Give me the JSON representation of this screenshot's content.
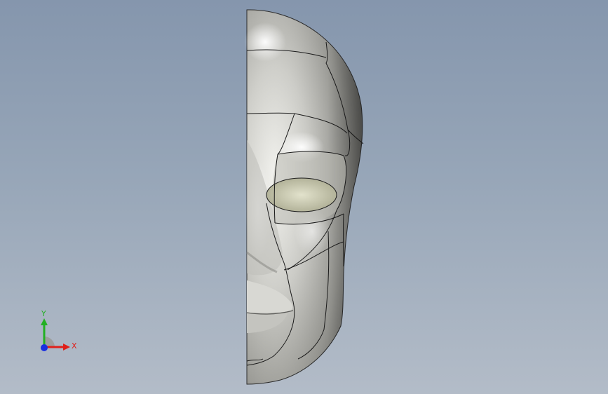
{
  "viewport": {
    "background_top": "#8596ad",
    "background_bottom": "#b3bcc8"
  },
  "model": {
    "name": "half-head-face-surface-model",
    "surface_color": "#c9c9c3",
    "edge_color": "#1a1a1a"
  },
  "triad": {
    "x_label": "X",
    "y_label": "Y",
    "x_color": "#e0201a",
    "y_color": "#22b022",
    "z_color": "#1a2fe0"
  }
}
